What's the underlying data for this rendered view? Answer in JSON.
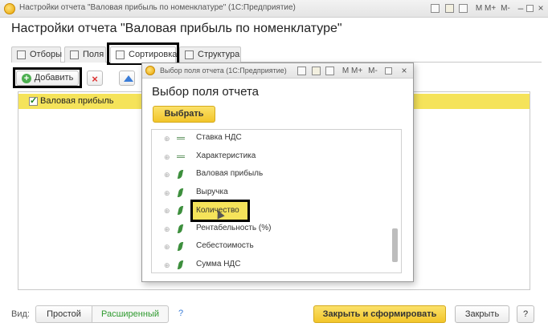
{
  "window": {
    "title": "Настройки отчета \"Валовая прибыль по номенклатуре\" (1С:Предприятие)",
    "buttons": [
      "M",
      "M+",
      "M-"
    ]
  },
  "heading": "Настройки отчета \"Валовая прибыль по номенклатуре\"",
  "tabs": [
    {
      "label": "Отборы"
    },
    {
      "label": "Поля"
    },
    {
      "label": "Сортировка",
      "active": true
    },
    {
      "label": "Структура"
    }
  ],
  "toolbar": {
    "add_label": "Добавить"
  },
  "table": {
    "rows": [
      {
        "label": "Валовая прибыль",
        "checked": true,
        "selected": true
      }
    ]
  },
  "bottom": {
    "view_label": "Вид:",
    "simple_label": "Простой",
    "extended_label": "Расширенный",
    "help_label": "?",
    "generate_label": "Закрыть и сформировать",
    "close_label": "Закрыть",
    "help_button_label": "?"
  },
  "dialog": {
    "title": "Выбор поля отчета (1С:Предприятие)",
    "buttons": [
      "M",
      "M+",
      "M-"
    ],
    "heading": "Выбор поля отчета",
    "select_label": "Выбрать",
    "items": [
      {
        "label": "Ставка НДС",
        "icon": "dash-icon"
      },
      {
        "label": "Характеристика",
        "icon": "dash-icon"
      },
      {
        "label": "Валовая прибыль",
        "icon": "leaf-icon"
      },
      {
        "label": "Выручка",
        "icon": "leaf-icon"
      },
      {
        "label": "Количество",
        "icon": "leaf-icon",
        "selected": true
      },
      {
        "label": "Рентабельность (%)",
        "icon": "leaf-icon"
      },
      {
        "label": "Себестоимость",
        "icon": "leaf-icon"
      },
      {
        "label": "Сумма НДС",
        "icon": "leaf-icon"
      }
    ]
  },
  "colors": {
    "accent_yellow": "#f5e35a",
    "primary_button": "#f7d23e",
    "highlight_border": "#000000",
    "link_green": "#2e9a2e"
  }
}
